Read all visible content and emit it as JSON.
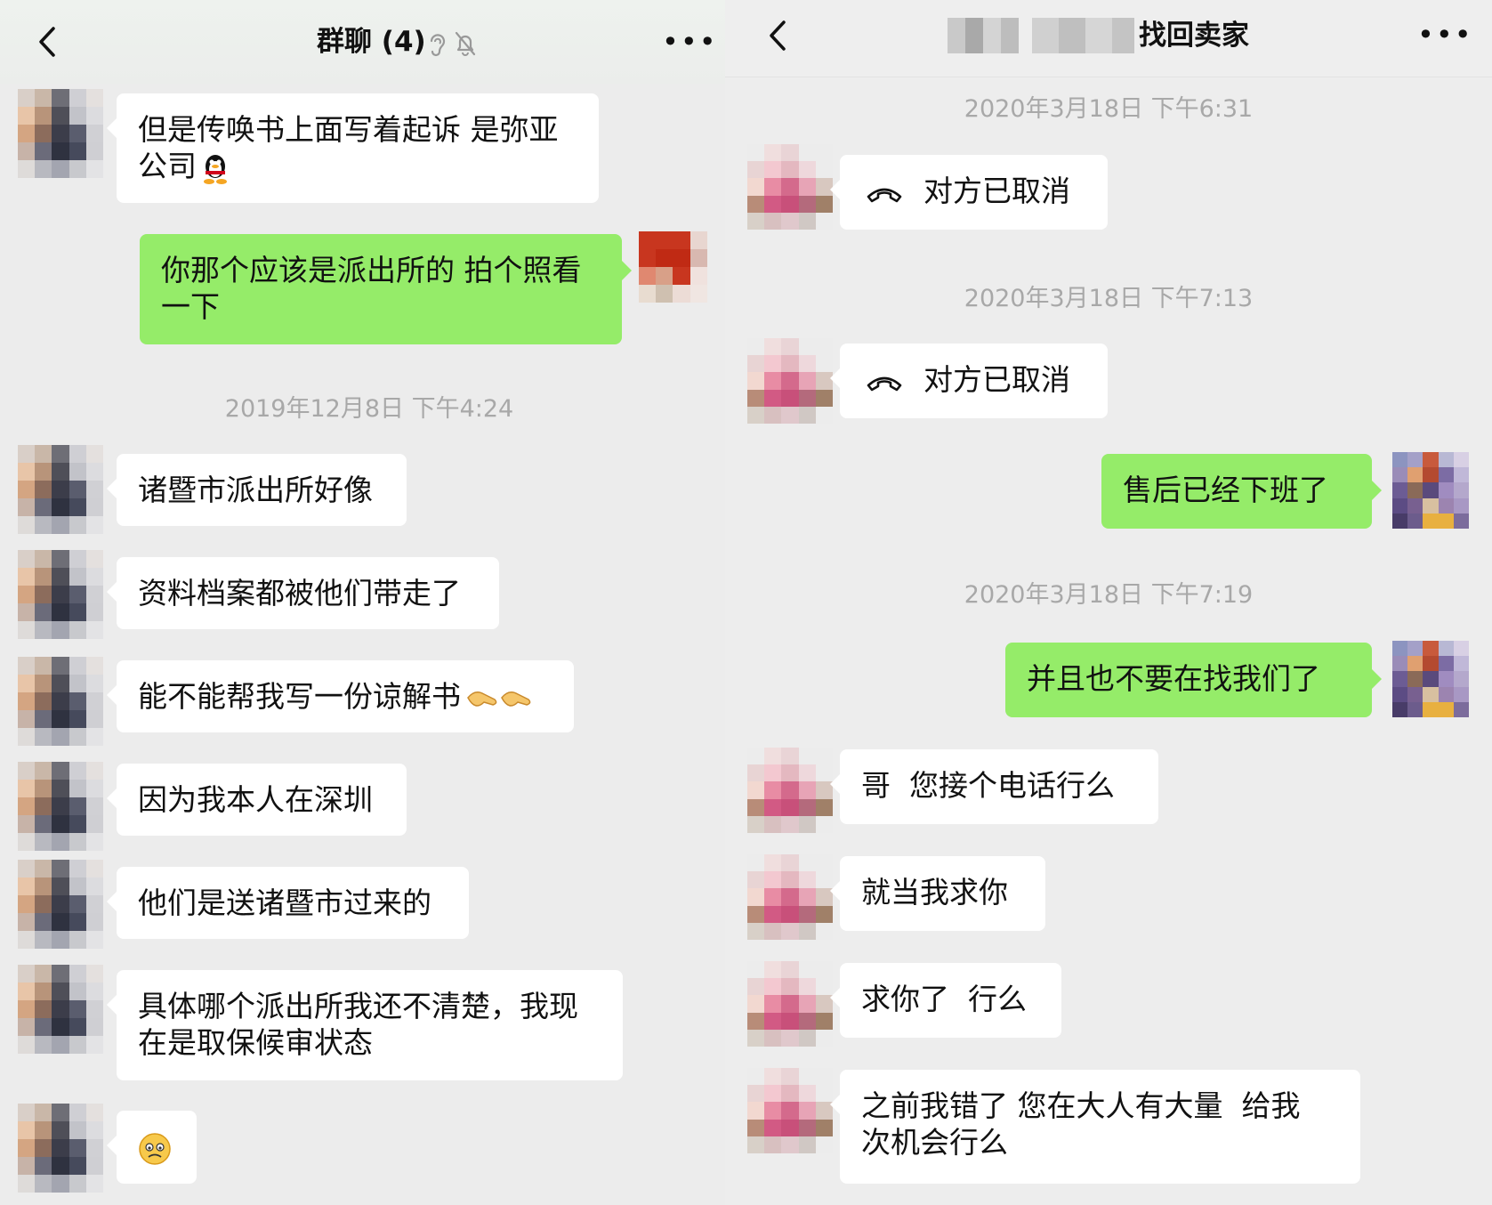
{
  "left": {
    "header": {
      "title": "群聊 (4)",
      "back_icon": "chevron-left-icon",
      "ear_icon": "earpiece-icon",
      "mute_icon": "bell-off-icon",
      "more_icon": "•••"
    },
    "messages": [
      {
        "text": "但是传唤书上面写着起诉 是弥亚\n公司",
        "side": "in",
        "emoji": "qq-penguin"
      },
      {
        "text": "你那个应该是派出所的 拍个照看\n一下",
        "side": "out"
      },
      {
        "text": "诸暨市派出所好像",
        "side": "in"
      },
      {
        "text": "资料档案都被他们带走了",
        "side": "in"
      },
      {
        "text": "能不能帮我写一份谅解书",
        "side": "in",
        "emoji": "handshake-handshake"
      },
      {
        "text": "因为我本人在深圳",
        "side": "in"
      },
      {
        "text": "他们是送诸暨市过来的",
        "side": "in"
      },
      {
        "text": "具体哪个派出所我还不清楚，我现\n在是取保候审状态",
        "side": "in"
      },
      {
        "text": "",
        "side": "in",
        "emoji": "awkward-face"
      }
    ],
    "timestamp": "2019年12月8日 下午4:24"
  },
  "right": {
    "header": {
      "title_visible": "找回卖家",
      "back_icon": "chevron-left-icon",
      "more_icon": "•••"
    },
    "timestamps": [
      "2020年3月18日 下午6:31",
      "2020年3月18日 下午7:13",
      "2020年3月18日 下午7:19"
    ],
    "messages": [
      {
        "text": "对方已取消",
        "side": "in",
        "icon": "phone-hangup-icon"
      },
      {
        "text": "对方已取消",
        "side": "in",
        "icon": "phone-hangup-icon"
      },
      {
        "text": "售后已经下班了",
        "side": "out"
      },
      {
        "text": "并且也不要在找我们了",
        "side": "out"
      },
      {
        "text": "哥  您接个电话行么",
        "side": "in"
      },
      {
        "text": "就当我求你",
        "side": "in"
      },
      {
        "text": "求你了  行么",
        "side": "in"
      },
      {
        "text": "之前我错了 您在大人有大量  给我\n次机会行么",
        "side": "in"
      }
    ]
  },
  "colors": {
    "background": "#ededed",
    "incoming_bubble": "#ffffff",
    "outgoing_bubble": "#95ec69",
    "timestamp_text": "#a8a8a8"
  }
}
